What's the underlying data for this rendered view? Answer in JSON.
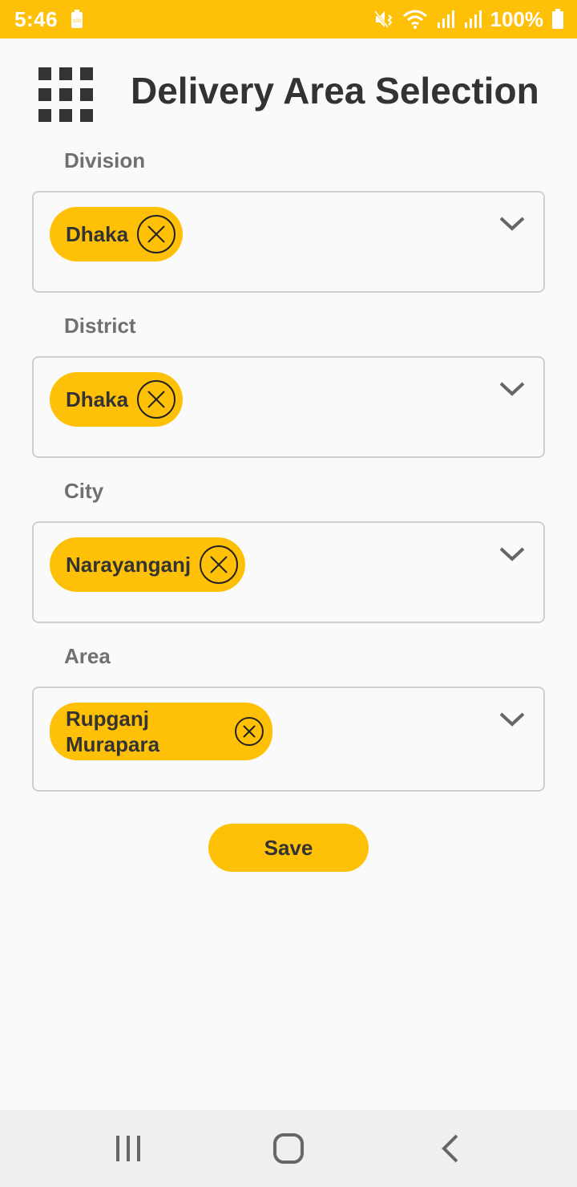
{
  "status_bar": {
    "time": "5:46",
    "battery_percent": "100%",
    "battery_icon_label": "100",
    "icons": [
      "battery-saver-icon",
      "mute-vibrate-icon",
      "wifi-icon",
      "signal-icon",
      "signal-icon",
      "battery-icon"
    ],
    "background": "#ffc107"
  },
  "header": {
    "title": "Delivery Area Selection",
    "menu_icon": "grid-icon"
  },
  "fields": [
    {
      "label": "Division",
      "selected": "Dhaka"
    },
    {
      "label": "District",
      "selected": "Dhaka"
    },
    {
      "label": "City",
      "selected": "Narayanganj"
    },
    {
      "label": "Area",
      "selected": "Rupganj Murapara"
    }
  ],
  "actions": {
    "save_label": "Save"
  },
  "nav_bar": {
    "icons": [
      "recent-apps-icon",
      "home-icon",
      "back-icon"
    ]
  },
  "colors": {
    "accent": "#ffc107",
    "text": "#333333",
    "label": "#707070",
    "border": "#cfcfcf"
  }
}
